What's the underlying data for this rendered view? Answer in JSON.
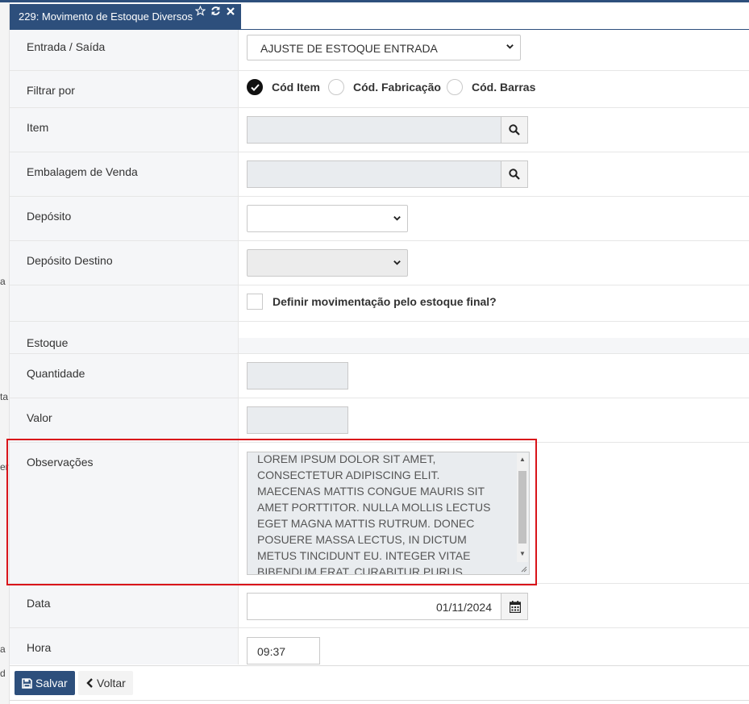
{
  "tab": {
    "title": "229: Movimento de Estoque Diversos",
    "icons": [
      "star-icon",
      "refresh-icon",
      "close-icon"
    ]
  },
  "left_edge_fragments": [
    "a",
    "ta",
    "er",
    "a",
    "d"
  ],
  "form": {
    "entrada_saida": {
      "label": "Entrada / Saída",
      "value": "AJUSTE DE ESTOQUE ENTRADA"
    },
    "filtrar_por": {
      "label": "Filtrar por",
      "options": [
        "Cód Item",
        "Cód. Fabricação",
        "Cód. Barras"
      ],
      "selected": "Cód Item"
    },
    "item": {
      "label": "Item"
    },
    "embalagem": {
      "label": "Embalagem de Venda"
    },
    "deposito": {
      "label": "Depósito",
      "value": ""
    },
    "deposito_destino": {
      "label": "Depósito Destino",
      "value": ""
    },
    "definir": {
      "label": "Definir movimentação pelo estoque final?",
      "checked": false
    },
    "estoque_section": "Estoque",
    "quantidade": {
      "label": "Quantidade"
    },
    "valor": {
      "label": "Valor"
    },
    "observacoes": {
      "label": "Observações",
      "value": "LOREM IPSUM DOLOR SIT AMET, CONSECTETUR ADIPISCING ELIT. MAECENAS MATTIS CONGUE MAURIS SIT AMET PORTTITOR. NULLA MOLLIS LECTUS EGET MAGNA MATTIS RUTRUM. DONEC POSUERE MASSA LECTUS, IN DICTUM METUS TINCIDUNT EU. INTEGER VITAE BIBENDUM ERAT. CURABITUR PURUS"
    },
    "data": {
      "label": "Data",
      "value": "01/11/2024"
    },
    "hora": {
      "label": "Hora",
      "value": "09:37"
    }
  },
  "footer": {
    "save_label": "Salvar",
    "back_label": "Voltar"
  },
  "colors": {
    "primary": "#2d4f7c",
    "highlight": "#d9141a",
    "label_bg": "#f5f6f8",
    "disabled_input": "#e9ecef"
  }
}
